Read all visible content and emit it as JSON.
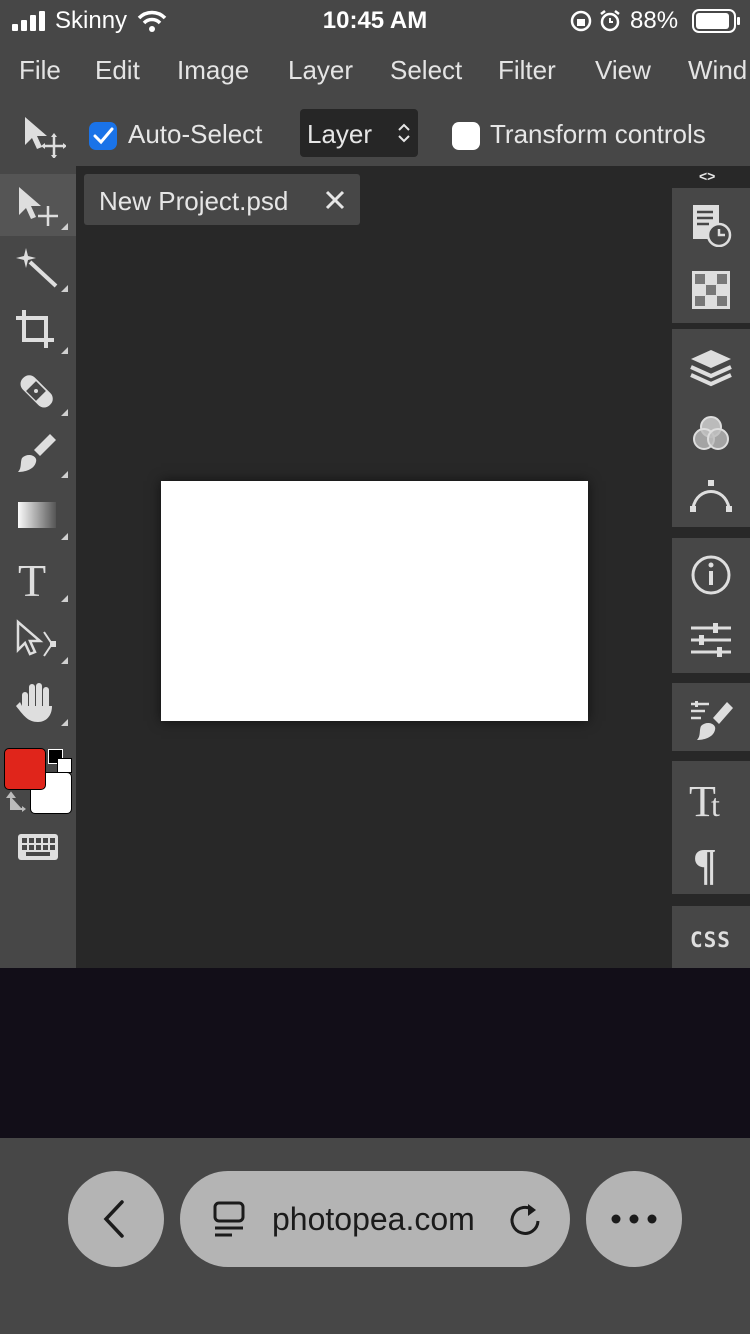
{
  "status": {
    "carrier": "Skinny",
    "time": "10:45 AM",
    "battery_pct": "88%"
  },
  "menu": [
    "File",
    "Edit",
    "Image",
    "Layer",
    "Select",
    "Filter",
    "View",
    "Wind"
  ],
  "options": {
    "auto_select_label": "Auto-Select",
    "auto_select_checked": true,
    "layer_select_value": "Layer",
    "transform_controls_label": "Transform controls",
    "transform_controls_checked": false
  },
  "tools": [
    "move-tool",
    "magic-wand-tool",
    "crop-tool",
    "healing-brush-tool",
    "brush-tool",
    "gradient-tool",
    "type-tool",
    "path-select-tool",
    "hand-tool"
  ],
  "colors": {
    "foreground": "#e0251b",
    "background": "#ffffff",
    "accent": "#1a73e8",
    "ui_bg": "#474747",
    "workspace_bg": "#282828"
  },
  "document": {
    "tab_title": "New Project.psd"
  },
  "panels": {
    "collapse_toggle": "<>",
    "css_label": "CSS"
  },
  "browser": {
    "url": "photopea.com"
  }
}
